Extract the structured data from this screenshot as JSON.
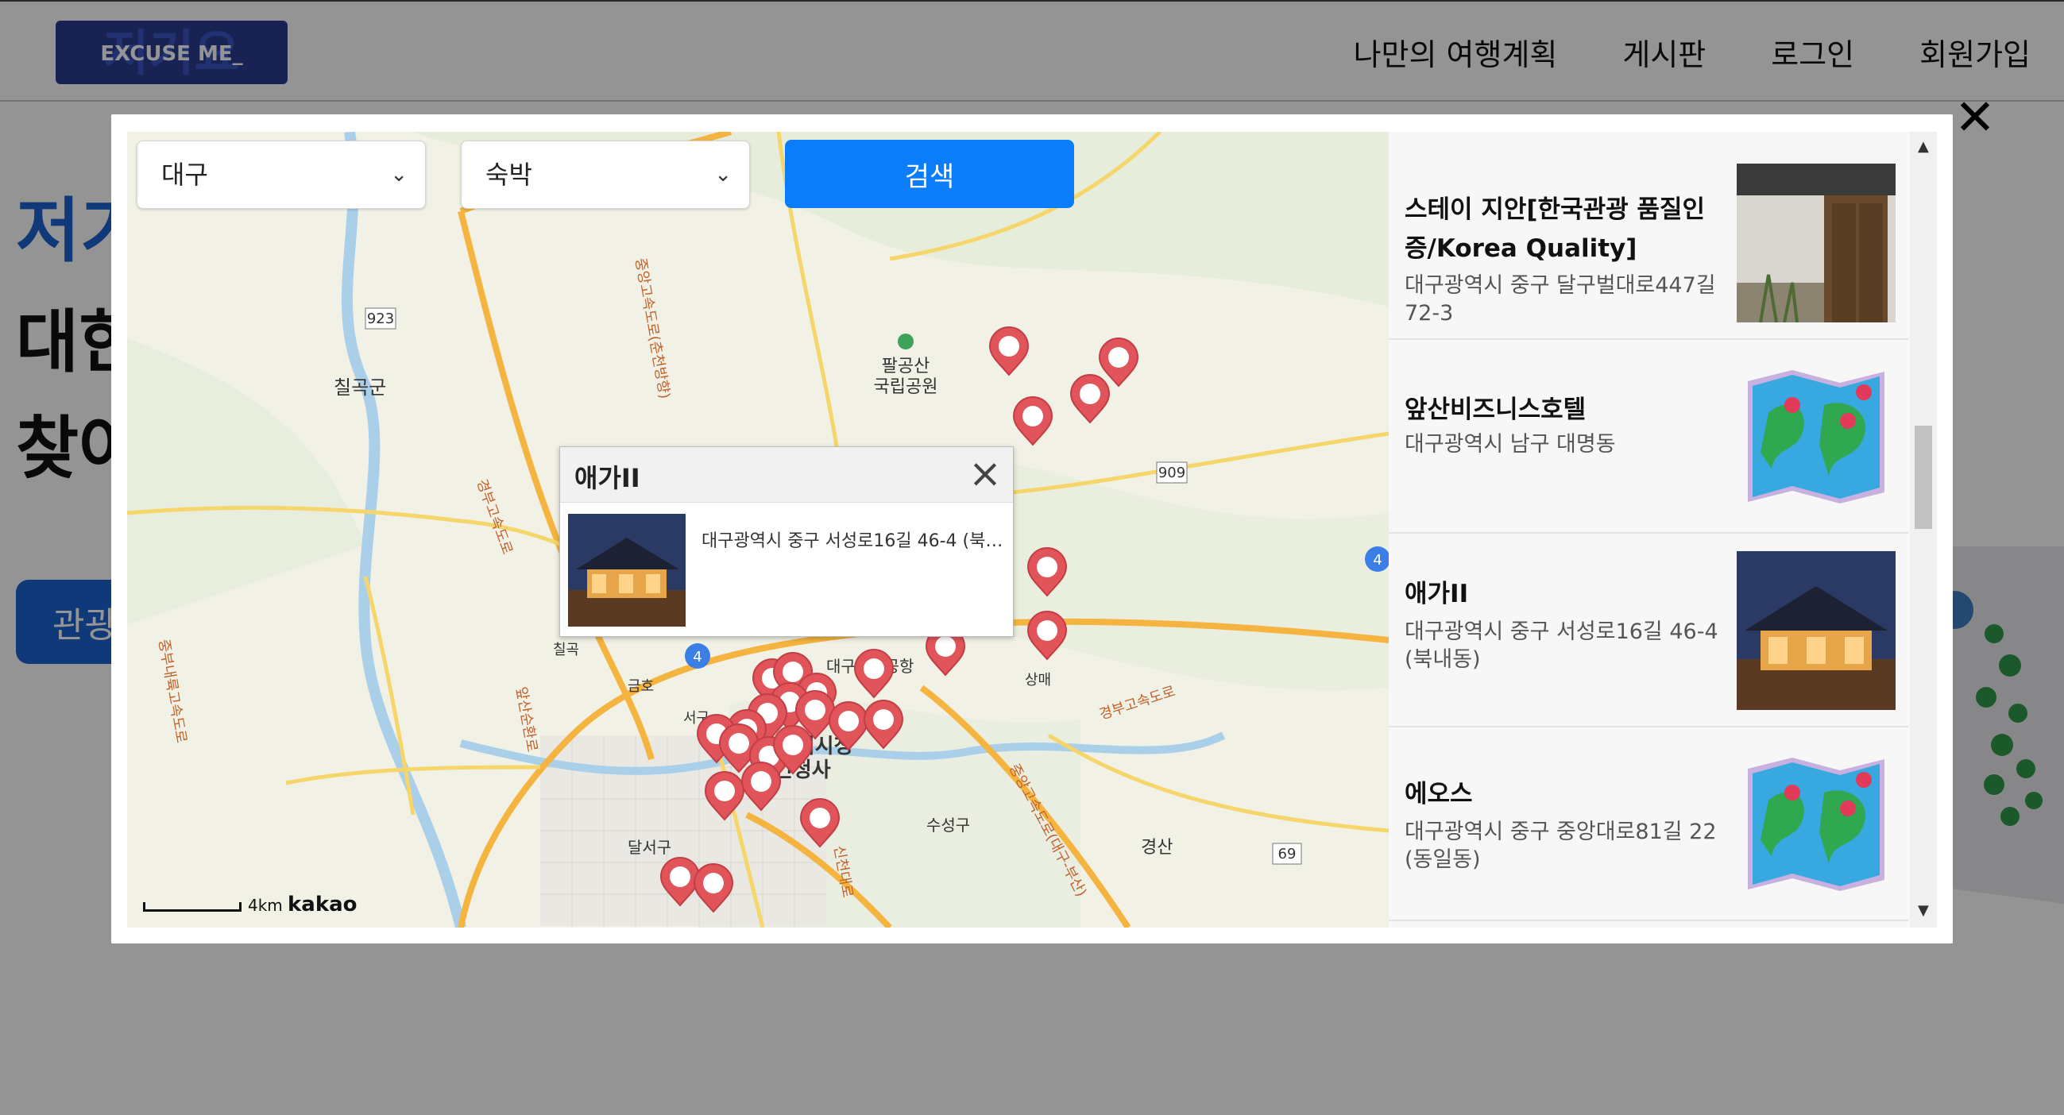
{
  "header": {
    "logo_text": "저기요",
    "logo_sub": "EXCUSE ME_",
    "nav": [
      "나만의 여행계획",
      "게시판",
      "로그인",
      "회원가입"
    ]
  },
  "hero": {
    "title": "저기",
    "line1": "대한",
    "line2": "찾아",
    "button": "관광"
  },
  "modal": {
    "close_symbol": "✕",
    "region_select": "대구",
    "category_select": "숙박",
    "search_label": "검색"
  },
  "map": {
    "labels": {
      "palgongsan": "팔공산",
      "national_park": "국립공원",
      "chilgok": "칠곡군",
      "chilgok_small": "칠곡",
      "geumho": "금호",
      "seogu": "서구",
      "dalseogu": "달서구",
      "suseonggu": "수성구",
      "gyeongsan": "경산",
      "city_hall": "대구광역시청",
      "city_hall2": "동인청사",
      "sangmae": "상매",
      "airport": "대구국제공항",
      "road_923": "923",
      "road_909": "909",
      "road_4": "4",
      "road_69": "69",
      "expressway1": "중앙고속도로(춘천방향)",
      "expressway2": "경부고속도로",
      "expressway3": "중부내륙고속도로",
      "expressway4": "경부고속도로",
      "expressway5": "중앙고속도로(대구-부산)",
      "road_sinchon": "신천대로",
      "road_apsan": "앞산순환로"
    },
    "popup": {
      "title": "애가II",
      "address": "대구광역시 중구 서성로16길 46-4 (북내동)"
    },
    "scale_text": "4km",
    "brand": "kakao"
  },
  "results": [
    {
      "name": "스테이 지안[한국관광 품질인증/Korea Quality]",
      "address": "대구광역시 중구 달구벌대로447길 72-3",
      "thumb": "hanok-door-photo"
    },
    {
      "name": "앞산비즈니스호텔",
      "address": "대구광역시 남구 대명동",
      "thumb": "map-placeholder-icon"
    },
    {
      "name": "애가II",
      "address": "대구광역시 중구 서성로16길 46-4 (북내동)",
      "thumb": "hanok-night-photo"
    },
    {
      "name": "에오스",
      "address": "대구광역시 중구 중앙대로81길 22 (동일동)",
      "thumb": "map-placeholder-icon"
    }
  ],
  "colors": {
    "accent": "#0b7dfb",
    "brand_blue": "#1c63d3",
    "marker": "#e0545a"
  }
}
